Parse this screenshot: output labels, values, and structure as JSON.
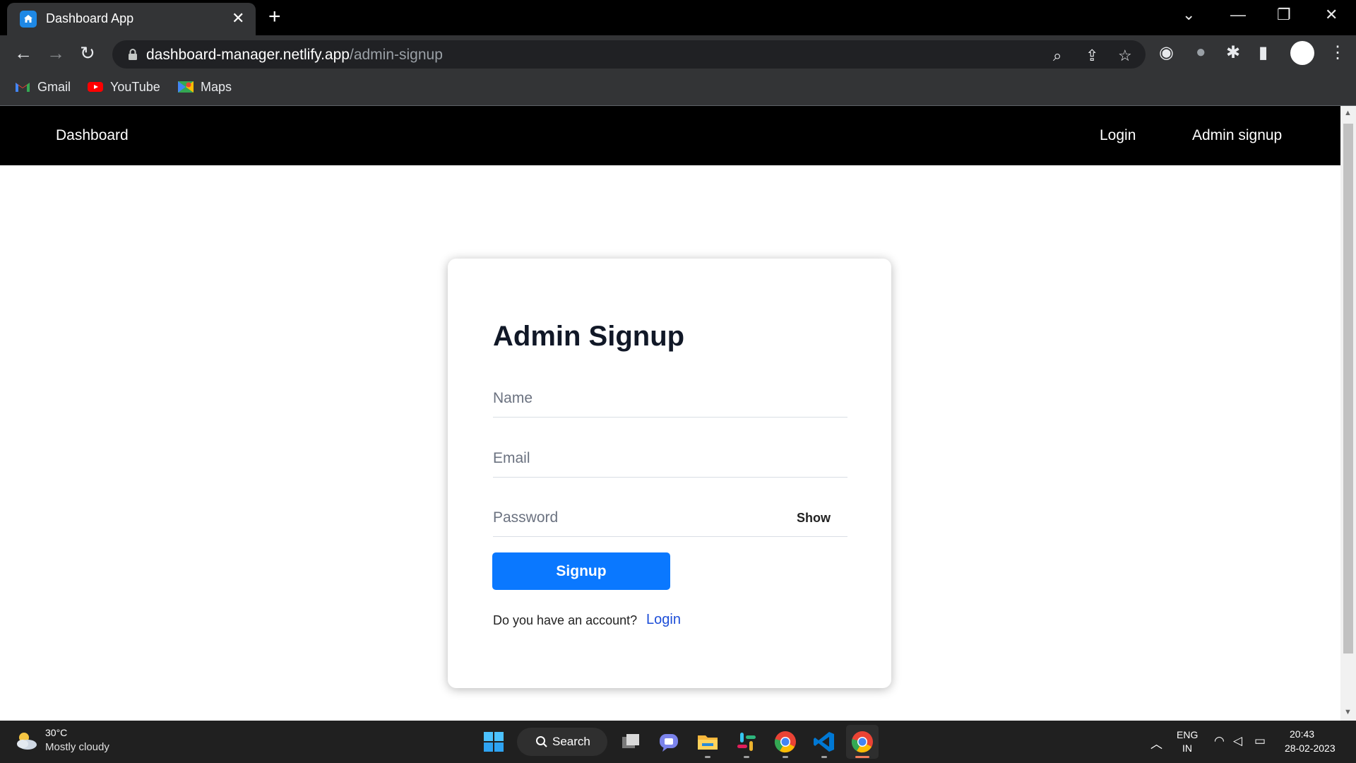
{
  "browser": {
    "tab_title": "Dashboard App",
    "tab_close": "✕",
    "new_tab": "+",
    "url_host": "dashboard-manager.netlify.app",
    "url_path": "/admin-signup",
    "bookmarks": [
      {
        "label": "Gmail",
        "icon": "gmail-icon"
      },
      {
        "label": "YouTube",
        "icon": "youtube-icon"
      },
      {
        "label": "Maps",
        "icon": "maps-icon"
      }
    ]
  },
  "navbar": {
    "brand": "Dashboard",
    "links": [
      "Login",
      "Admin signup"
    ]
  },
  "form": {
    "title": "Admin Signup",
    "name_placeholder": "Name",
    "email_placeholder": "Email",
    "password_placeholder": "Password",
    "show_label": "Show",
    "submit_label": "Signup",
    "account_prompt": "Do you have an account?",
    "login_link": "Login"
  },
  "taskbar": {
    "temperature": "30°C",
    "weather": "Mostly cloudy",
    "search_label": "Search",
    "language": "ENG",
    "region": "IN",
    "time": "20:43",
    "date": "28-02-2023"
  },
  "colors": {
    "primary_button": "#0a78ff",
    "navbar_bg": "#000000",
    "link": "#1d4ed8"
  }
}
